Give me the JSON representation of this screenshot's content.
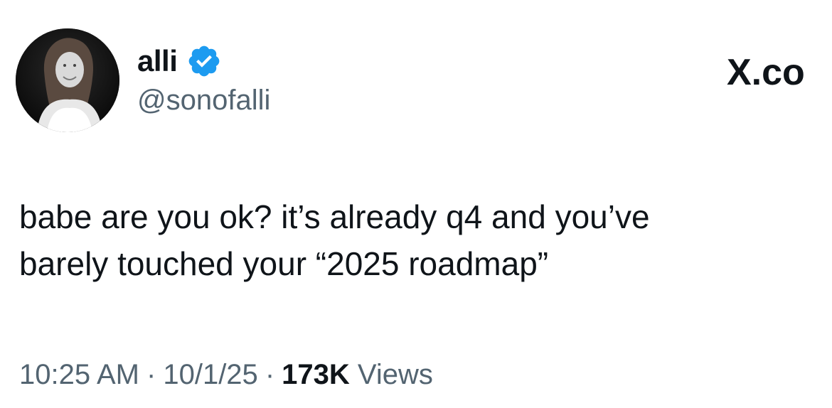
{
  "author": {
    "display_name": "alli",
    "handle": "@sonofalli",
    "verified": true,
    "avatar_icon": "profile-photo",
    "verified_icon": "verified-badge-icon",
    "verified_color": "#1d9bf0"
  },
  "brand": {
    "label": "X.co"
  },
  "tweet": {
    "text": "babe are you ok? it’s already q4 and you’ve\nbarely touched your “2025 roadmap”"
  },
  "meta": {
    "time": "10:25 AM",
    "date": "10/1/25",
    "separator": "·",
    "views_count": "173K",
    "views_label": "Views"
  },
  "colors": {
    "text_primary": "#0f1419",
    "text_secondary": "#536471",
    "background": "#ffffff"
  }
}
